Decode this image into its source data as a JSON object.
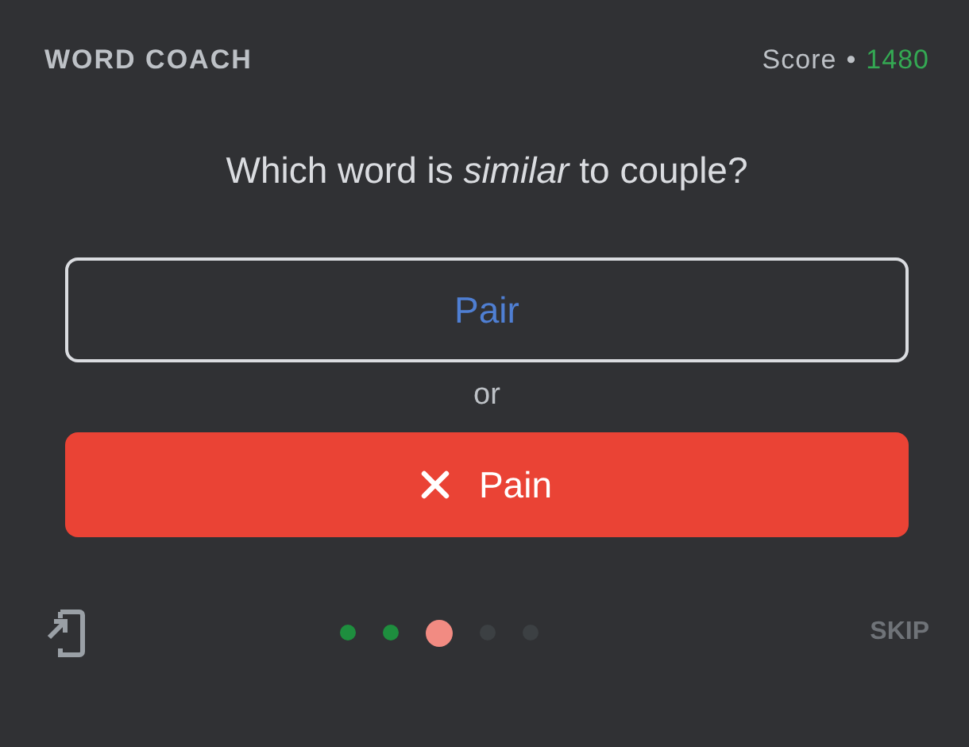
{
  "header": {
    "title": "WORD COACH",
    "score_label": "Score",
    "separator": "•",
    "score": "1480"
  },
  "question": "Which word is *similar* to couple?",
  "options": [
    {
      "kind": "outline",
      "label": "Pair"
    },
    {
      "kind": "wrong",
      "label": "Pain"
    }
  ],
  "divider": "or",
  "progress": [
    {
      "color": "#1e8e3e",
      "selected": false
    },
    {
      "color": "#1e8e3e",
      "selected": false
    },
    {
      "color": "#f28b82",
      "selected": true
    },
    {
      "color": "#3c4043",
      "selected": false
    },
    {
      "color": "#3c4043",
      "selected": false
    }
  ],
  "skip": "SKIP"
}
